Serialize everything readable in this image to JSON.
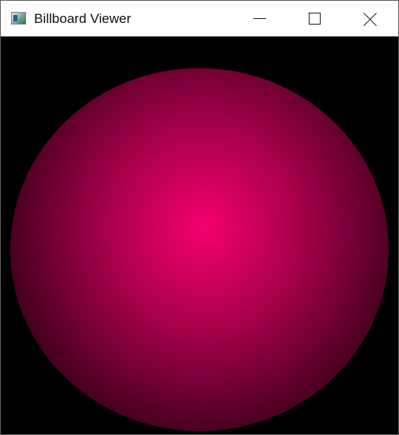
{
  "window": {
    "title": "Billboard Viewer",
    "icon": "application-icon",
    "controls": {
      "minimize": "minimize-icon",
      "maximize": "maximize-icon",
      "close": "close-icon"
    }
  },
  "viewport": {
    "background_color": "#000000",
    "billboard": {
      "shape": "radial-gradient-circle",
      "center_color": "#f5006e",
      "edge_color": "#000000"
    }
  }
}
